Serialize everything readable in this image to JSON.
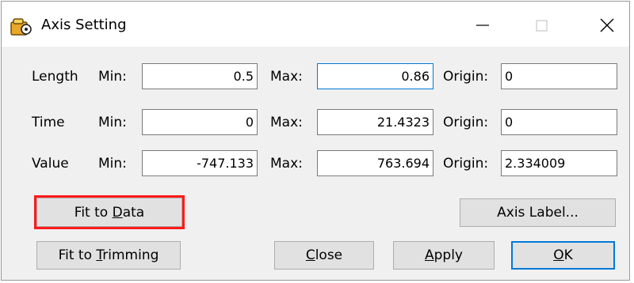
{
  "window": {
    "title": "Axis Setting",
    "icon": "axis-setting-app-icon"
  },
  "rows": [
    {
      "name": "Length",
      "min_label": "Min:",
      "min": "0.5",
      "max_label": "Max:",
      "max": "0.86",
      "origin_label": "Origin:",
      "origin": "0"
    },
    {
      "name": "Time",
      "min_label": "Min:",
      "min": "0",
      "max_label": "Max:",
      "max": "21.4323",
      "origin_label": "Origin:",
      "origin": "0"
    },
    {
      "name": "Value",
      "min_label": "Min:",
      "min": "-747.133",
      "max_label": "Max:",
      "max": "763.694",
      "origin_label": "Origin:",
      "origin": "2.334009"
    }
  ],
  "buttons": {
    "fit_to_data": {
      "before": "Fit to ",
      "mnemonic": "D",
      "after": "ata"
    },
    "axis_label": "Axis Label...",
    "fit_to_trimming": {
      "before": "Fit to ",
      "mnemonic": "T",
      "after": "rimming"
    },
    "close": {
      "before": "",
      "mnemonic": "C",
      "after": "lose"
    },
    "apply": {
      "before": "",
      "mnemonic": "A",
      "after": "pply"
    },
    "ok": {
      "before": "",
      "mnemonic": "O",
      "after": "K"
    }
  },
  "highlight_color": "#ff1a1a",
  "accent_color": "#0078d7"
}
